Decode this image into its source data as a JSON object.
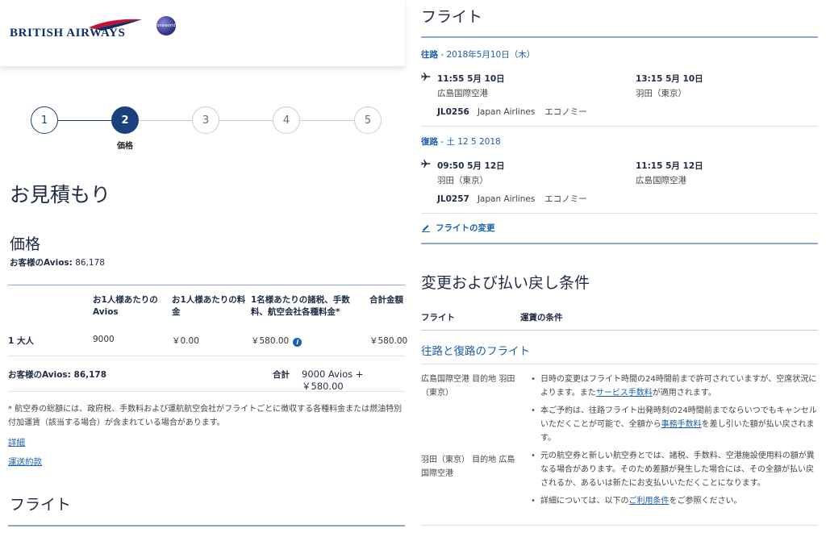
{
  "brand": {
    "name": "BRITISH AIRWAYS",
    "alliance_logo": "oneworld"
  },
  "steps": {
    "items": [
      "1",
      "2",
      "3",
      "4",
      "5"
    ],
    "active_label": "価格"
  },
  "quote": {
    "title": "お見積もり",
    "price_heading": "価格",
    "avios_balance_label": "お客様のAvios:",
    "avios_balance_value": "86,178",
    "table": {
      "headers": [
        "お1人様あたりの\nAvios",
        "お1人様あたりの料\n金",
        "1名様あたりの諸税、手数\n料、航空会社各種料金*",
        "合計金額"
      ],
      "row": {
        "pax": "1 大人",
        "avios": "9000",
        "fare": "￥0.00",
        "taxes": "￥580.00",
        "total": "￥580.00"
      },
      "footer_balance": "お客様のAvios: 86,178",
      "footer_total_label": "合計",
      "footer_total_value": "9000 Avios + ￥580.00"
    },
    "note": "* 航空券の総額には、政府税、手数料および運航航空会社がフライトごとに徴収する各種料金または燃油特別付加運賃（該当する場合）が含まれている場合があります。",
    "links": {
      "details": "詳細",
      "conditions": "運送約款"
    },
    "flight_heading": "フライト"
  },
  "flights": {
    "heading": "フライト",
    "outbound": {
      "label": "往路",
      "date": " - 2018年5月10日（木）",
      "dep_time": "11:55 5月 10日",
      "dep_place": "広島国際空港",
      "arr_time": "13:15 5月 10日",
      "arr_place": "羽田（東京）",
      "flight_no": "JL0256",
      "carrier": "Japan Airlines",
      "cabin": "エコノミー"
    },
    "return": {
      "label": "復路",
      "date": " - 土 12 5 2018",
      "dep_time": "09:50 5月 12日",
      "dep_place": "羽田（東京）",
      "arr_time": "11:15 5月 12日",
      "arr_place": "広島国際空港",
      "flight_no": "JL0257",
      "carrier": "Japan Airlines",
      "cabin": "エコノミー"
    },
    "change_link": "フライトの変更"
  },
  "conditions": {
    "heading": "変更および払い戻し条件",
    "col_flight": "フライト",
    "col_fare": "運賃の条件",
    "sub_heading": "往路と復路のフライト",
    "route_out": "広島国際空港 目的地 羽田（東京）",
    "route_ret": "羽田（東京） 目的地 広島国際空港",
    "b1_pre": "日時の変更はフライト時間の24時間前まで許可されていますが、空席状況によります。また",
    "b1_link": "サービス手数料",
    "b1_post": "が適用されます。",
    "b2_pre": "本ご予約は、往路フライト出発時刻の24時間前までならいつでもキャンセルいただくことが可能で、全額から",
    "b2_link": "事務手数料",
    "b2_post": "を差し引いた額が払い戻されます。",
    "b3": "元の航空券と新しい航空券とでは、諸税、手数料、空港施設使用料の額が異なる場合があります。そのため差額が発生した場合には、その全額が払い戻されるか、あるいは新たにお支払いいただくことになります。",
    "b4_pre": "詳細については、以下の",
    "b4_link": "ご利用条件",
    "b4_post": "をご参照ください。"
  }
}
